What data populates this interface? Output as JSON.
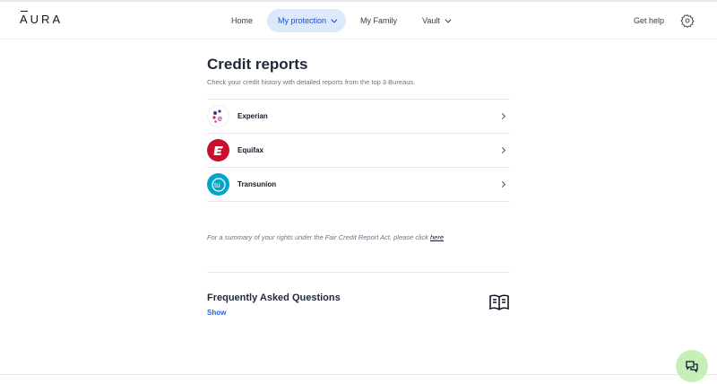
{
  "brand": {
    "logo_text": "AURA"
  },
  "nav": {
    "items": [
      {
        "label": "Home",
        "active": false,
        "dropdown": false
      },
      {
        "label": "My protection",
        "active": true,
        "dropdown": true
      },
      {
        "label": "My Family",
        "active": false,
        "dropdown": false
      },
      {
        "label": "Vault",
        "active": false,
        "dropdown": true
      }
    ],
    "help_label": "Get help",
    "settings_icon": "gear-icon"
  },
  "page": {
    "title": "Credit reports",
    "subtitle": "Check your credit history with detailed reports from the top 3 Bureaus."
  },
  "bureaus": [
    {
      "name": "Experian",
      "icon": "experian-logo",
      "color": "#6b2a8a"
    },
    {
      "name": "Equifax",
      "icon": "equifax-logo",
      "color": "#c8102e"
    },
    {
      "name": "Transunion",
      "icon": "transunion-logo",
      "color": "#00a6ca"
    }
  ],
  "rights": {
    "text": "For a summary of your rights under the Fair Credit Report Act, please click",
    "link_label": "here"
  },
  "faq": {
    "title": "Frequently Asked Questions",
    "toggle_label": "Show",
    "icon": "book-icon"
  },
  "chat": {
    "icon": "chat-icon",
    "color": "#c7f0b8"
  },
  "accent_color": "#2563eb"
}
